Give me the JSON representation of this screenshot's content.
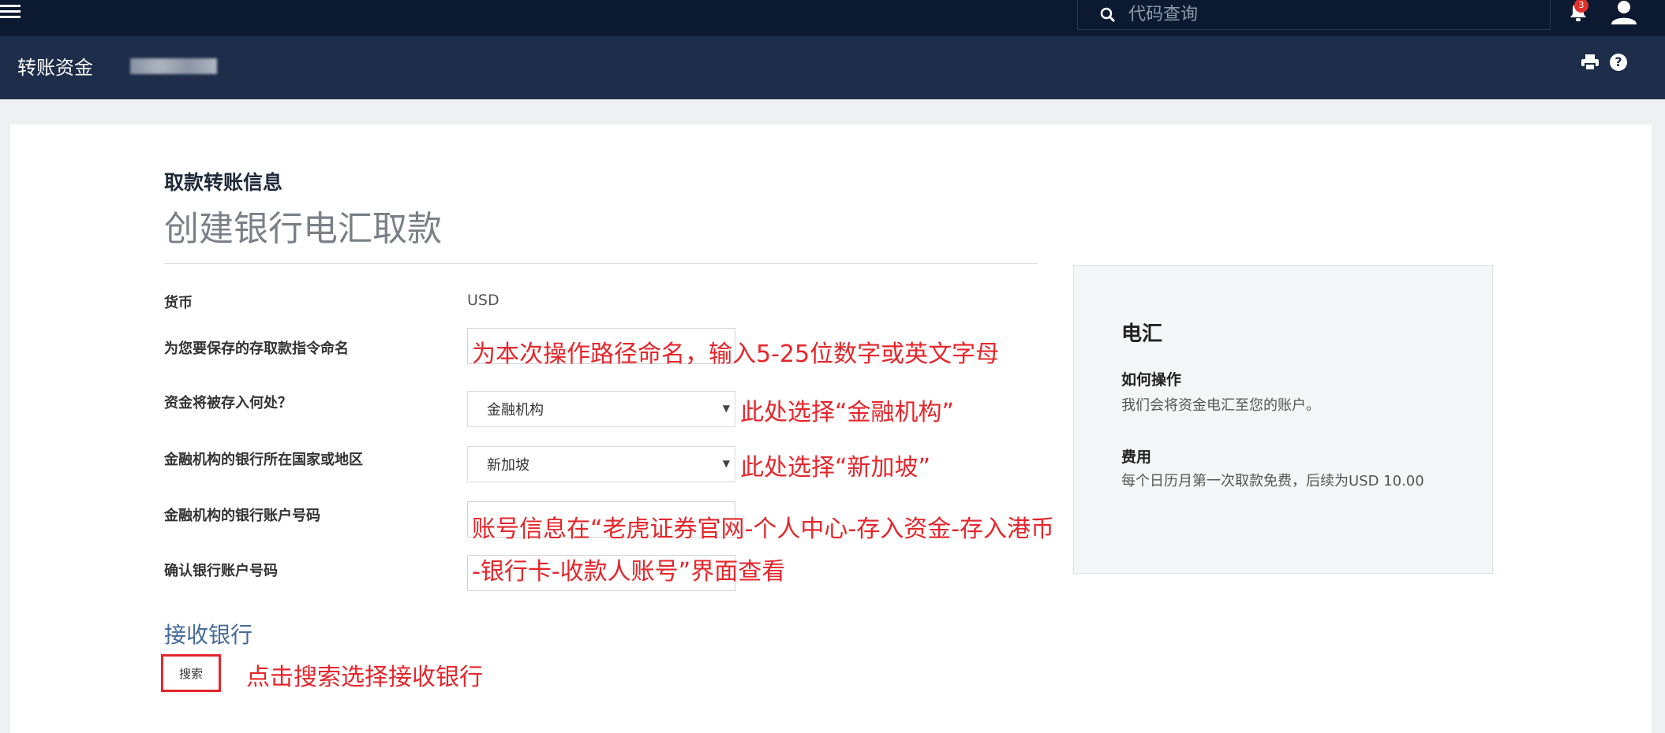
{
  "topbar": {
    "search_placeholder": "代码查询",
    "notification_count": "3",
    "icons": [
      "menu-icon",
      "search-icon",
      "bell-icon",
      "user-icon"
    ]
  },
  "subbar": {
    "title": "转账资金",
    "icons": [
      "print-icon",
      "help-icon"
    ],
    "help_glyph": "?"
  },
  "form": {
    "section_heading": "取款转账信息",
    "title": "创建银行电汇取款",
    "fields": [
      {
        "label": "货币",
        "value": "USD"
      },
      {
        "label": "为您要保存的存取款指令命名",
        "value": ""
      },
      {
        "label": "资金将被存入何处？",
        "selected": "金融机构"
      },
      {
        "label": "金融机构的银行所在国家或地区",
        "selected": "新加坡"
      },
      {
        "label": "金融机构的银行账户号码",
        "value": ""
      },
      {
        "label": "确认银行账户号码",
        "value": ""
      }
    ],
    "receiving_bank_title": "接收银行",
    "search_button": "搜索"
  },
  "annotations": {
    "name_hint": "为本次操作路径命名，输入5-25位数字或英文字母",
    "dest_hint": "此处选择“金融机构”",
    "country_hint": "此处选择“新加坡”",
    "account_hint_line1": "账号信息在“老虎证券官网-个人中心-存入资金-存入港币",
    "account_hint_line2": "-银行卡-收款人账号”界面查看",
    "search_hint": "点击搜索选择接收银行"
  },
  "sidebar": {
    "title": "电汇",
    "how_heading": "如何操作",
    "how_text": "我们会将资金电汇至您的账户。",
    "fee_heading": "费用",
    "fee_text": "每个日历月第一次取款免费，后续为USD 10.00"
  },
  "colors": {
    "topbar": "#0c1a31",
    "subbar": "#1d2d4a",
    "annotation": "#e5262b",
    "link": "#466a9a"
  }
}
